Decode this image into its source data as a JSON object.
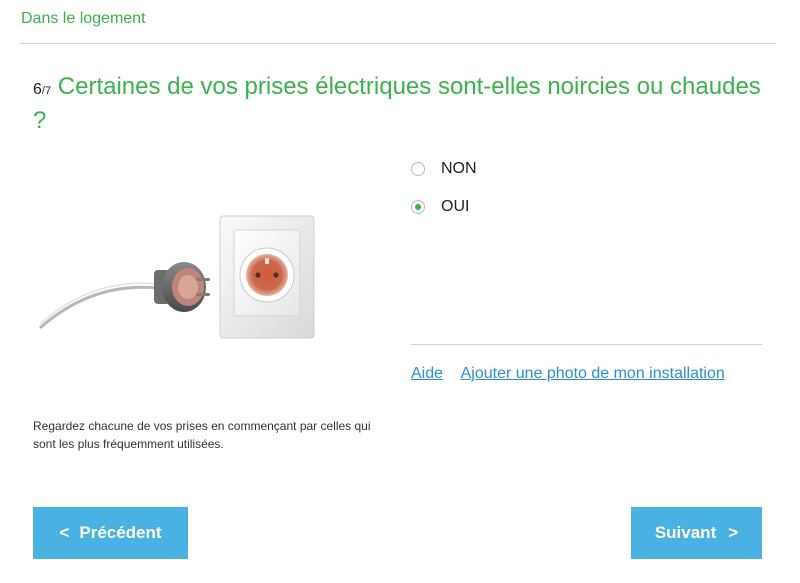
{
  "section": {
    "title": "Dans le logement"
  },
  "question": {
    "step": "6",
    "total": "/7",
    "text": "Certaines de vos prises électriques sont-elles noircies ou chaudes ?"
  },
  "illustration": {
    "icon": "electrical-outlet-with-plug-icon"
  },
  "hint": {
    "text": "Regardez chacune de vos prises en commençant par celles qui sont les plus fréquemment utilisées."
  },
  "options": [
    {
      "label": "NON",
      "selected": false
    },
    {
      "label": "OUI",
      "selected": true
    }
  ],
  "links": {
    "help": "Aide",
    "add_photo": "Ajouter une photo de mon installation"
  },
  "nav": {
    "prev_chevron": "<",
    "prev_label": "Précédent",
    "next_label": "Suivant",
    "next_chevron": ">"
  },
  "colors": {
    "accent_green": "#3bb34a",
    "button_blue": "#4ab2e3",
    "link_blue": "#2d8fd5"
  }
}
